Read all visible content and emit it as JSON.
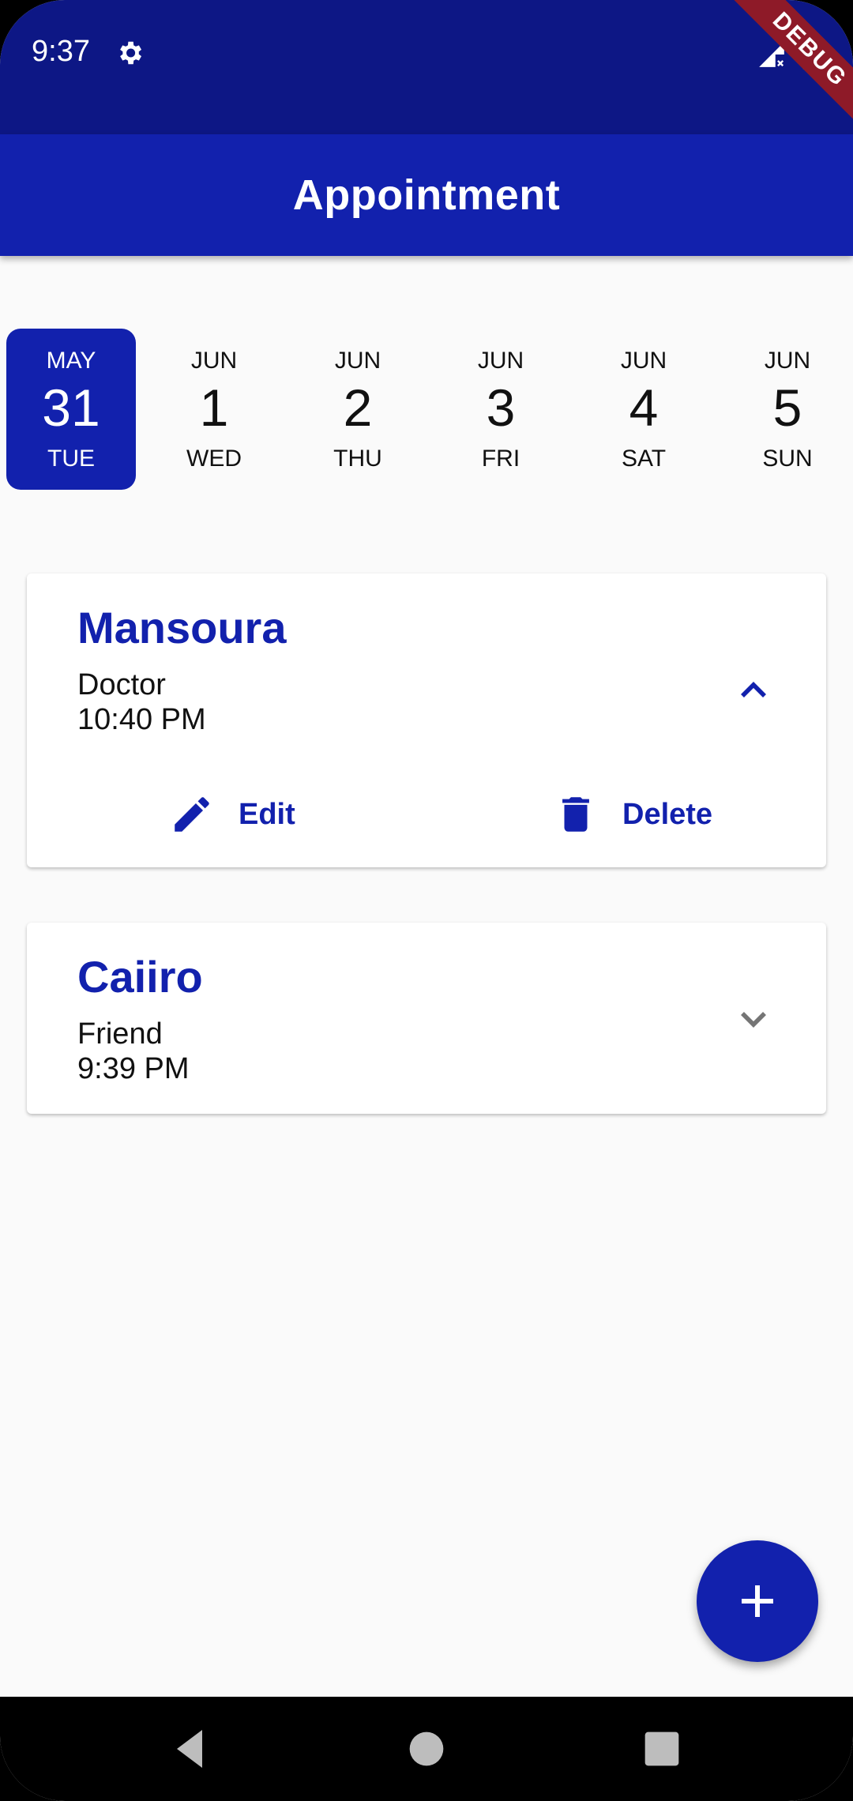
{
  "status_bar": {
    "time": "9:37",
    "debug_label": "DEBUG"
  },
  "app_bar": {
    "title": "Appointment"
  },
  "date_strip": {
    "items": [
      {
        "month": "MAY",
        "day": "31",
        "weekday": "TUE",
        "selected": true
      },
      {
        "month": "JUN",
        "day": "1",
        "weekday": "WED",
        "selected": false
      },
      {
        "month": "JUN",
        "day": "2",
        "weekday": "THU",
        "selected": false
      },
      {
        "month": "JUN",
        "day": "3",
        "weekday": "FRI",
        "selected": false
      },
      {
        "month": "JUN",
        "day": "4",
        "weekday": "SAT",
        "selected": false
      },
      {
        "month": "JUN",
        "day": "5",
        "weekday": "SUN",
        "selected": false
      }
    ]
  },
  "appointments": [
    {
      "name": "Mansoura",
      "type": "Doctor",
      "time": "10:40 PM",
      "expanded": true,
      "edit_label": "Edit",
      "delete_label": "Delete"
    },
    {
      "name": "Caiiro",
      "type": "Friend",
      "time": "9:39 PM",
      "expanded": false
    }
  ],
  "icons": {
    "settings": "gear-icon",
    "signal": "signal-icon",
    "battery": "battery-icon",
    "collapse": "chevron-up-icon",
    "expand": "chevron-down-icon",
    "edit": "pencil-icon",
    "delete": "trash-icon",
    "add": "plus-icon",
    "nav_back": "back-triangle-icon",
    "nav_home": "home-circle-icon",
    "nav_recents": "recents-square-icon"
  },
  "colors": {
    "status_bar": "#0D1785",
    "primary": "#1221AD",
    "background": "#FAFAFA",
    "debug_ribbon": "#8E1A28"
  }
}
